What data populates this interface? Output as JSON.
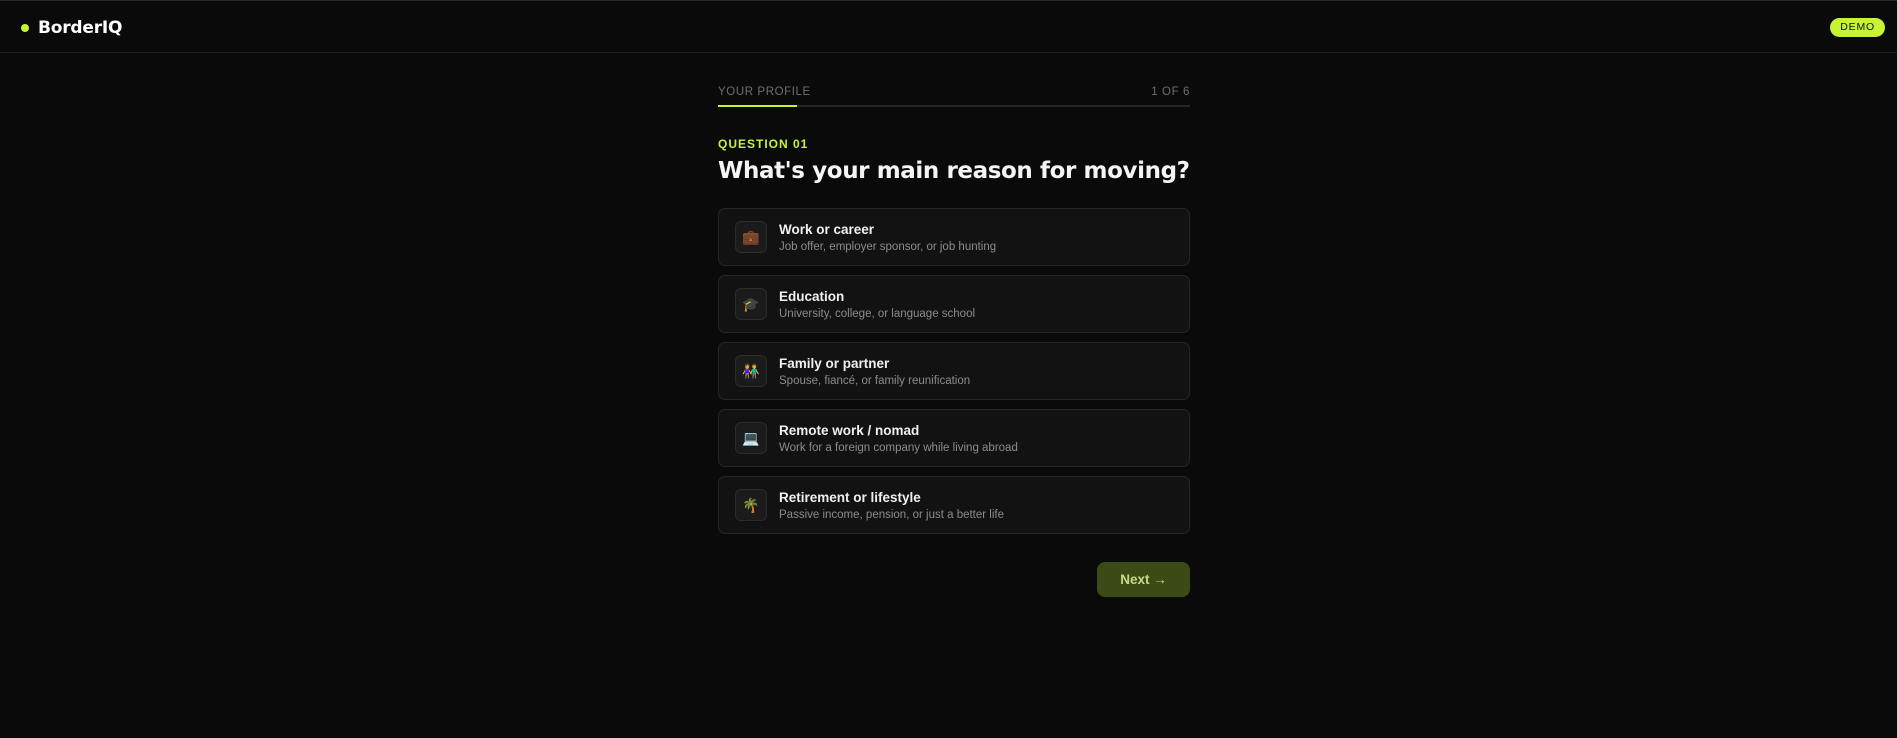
{
  "header": {
    "brand": "BorderIQ",
    "badge": "DEMO",
    "accent_color": "#c6f432"
  },
  "progress": {
    "label": "YOUR PROFILE",
    "count": "1 OF 6",
    "fraction": 0.1667
  },
  "question": {
    "number": "QUESTION 01",
    "title": "What's your main reason for moving?"
  },
  "options": [
    {
      "icon": "briefcase-icon",
      "glyph": "💼",
      "title": "Work or career",
      "desc": "Job offer, employer sponsor, or job hunting"
    },
    {
      "icon": "graduation-cap-icon",
      "glyph": "🎓",
      "title": "Education",
      "desc": "University, college, or language school"
    },
    {
      "icon": "family-icon",
      "glyph": "👫",
      "title": "Family or partner",
      "desc": "Spouse, fiancé, or family reunification"
    },
    {
      "icon": "laptop-icon",
      "glyph": "💻",
      "title": "Remote work / nomad",
      "desc": "Work for a foreign company while living abroad"
    },
    {
      "icon": "palm-tree-icon",
      "glyph": "🌴",
      "title": "Retirement or lifestyle",
      "desc": "Passive income, pension, or just a better life"
    }
  ],
  "actions": {
    "next_label": "Next →"
  }
}
